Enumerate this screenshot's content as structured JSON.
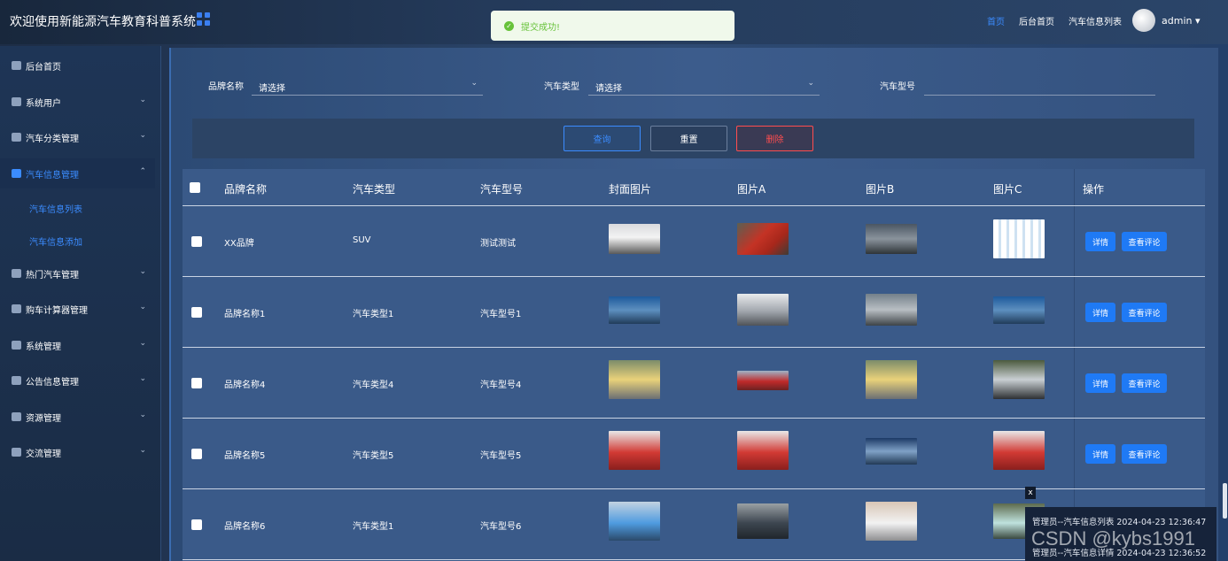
{
  "header": {
    "title": "欢迎使用新能源汽车教育科普系统",
    "nav": [
      "首页",
      "后台首页",
      "汽车信息列表"
    ],
    "user": "admin"
  },
  "toast": {
    "text": "提交成功!"
  },
  "sidebar": {
    "items": [
      {
        "label": "后台首页",
        "icon": "home-icon"
      },
      {
        "label": "系统用户",
        "icon": "user-icon"
      },
      {
        "label": "汽车分类管理",
        "icon": "grid-icon"
      },
      {
        "label": "汽车信息管理",
        "icon": "grid-icon"
      },
      {
        "label": "热门汽车管理",
        "icon": "grid-icon"
      },
      {
        "label": "购车计算器管理",
        "icon": "grid-icon"
      },
      {
        "label": "系统管理",
        "icon": "gear-icon"
      },
      {
        "label": "公告信息管理",
        "icon": "document-icon"
      },
      {
        "label": "资源管理",
        "icon": "pie-icon"
      },
      {
        "label": "交流管理",
        "icon": "chat-icon"
      }
    ],
    "sub": [
      "汽车信息列表",
      "汽车信息添加"
    ]
  },
  "filters": {
    "brand_label": "品牌名称",
    "brand_value": "请选择",
    "type_label": "汽车类型",
    "type_value": "请选择",
    "model_label": "汽车型号",
    "model_value": ""
  },
  "buttons": {
    "query": "查询",
    "reset": "重置",
    "delete": "删除"
  },
  "table": {
    "headers": [
      "品牌名称",
      "汽车类型",
      "汽车型号",
      "封面图片",
      "图片A",
      "图片B",
      "图片C",
      "操作"
    ],
    "rows": [
      {
        "brand": "XX品牌",
        "type": "SUV",
        "model": "测试测试"
      },
      {
        "brand": "品牌名称1",
        "type": "汽车类型1",
        "model": "汽车型号1"
      },
      {
        "brand": "品牌名称4",
        "type": "汽车类型4",
        "model": "汽车型号4"
      },
      {
        "brand": "品牌名称5",
        "type": "汽车类型5",
        "model": "汽车型号5"
      },
      {
        "brand": "品牌名称6",
        "type": "汽车类型1",
        "model": "汽车型号6"
      }
    ],
    "detail_btn": "详情",
    "comment_btn": "查看评论"
  },
  "log": {
    "line1": "管理员--汽车信息列表 2024-04-23 12:36:47",
    "line2": "管理员--汽车信息详情 2024-04-23 12:36:52",
    "close": "x"
  },
  "watermark": "CSDN @kybs1991",
  "colors": {
    "accent": "#3b8cff",
    "danger": "#ff4d4f",
    "success": "#67c23a"
  }
}
